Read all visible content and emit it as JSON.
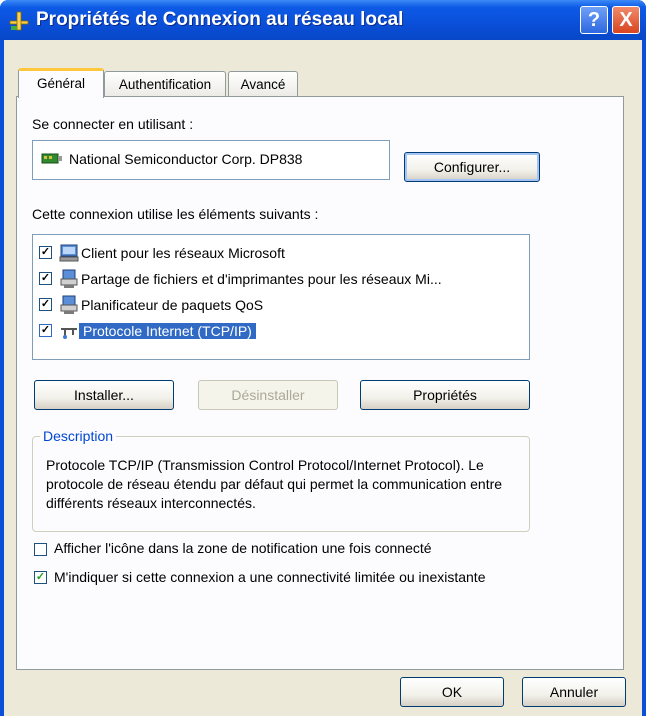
{
  "window": {
    "title": "Propriétés de Connexion au réseau local",
    "help_label": "?",
    "close_label": "X"
  },
  "tabs": [
    {
      "label": "Général",
      "active": true
    },
    {
      "label": "Authentification",
      "active": false
    },
    {
      "label": "Avancé",
      "active": false
    }
  ],
  "general": {
    "connect_using_label": "Se connecter en utilisant :",
    "adapter_name": "National Semiconductor Corp. DP838",
    "configure_label": "Configurer...",
    "items_label": "Cette connexion utilise les éléments suivants :",
    "items": [
      {
        "label": "Client pour les réseaux Microsoft",
        "checked": true,
        "icon": "network-client-icon"
      },
      {
        "label": "Partage de fichiers et d'imprimantes pour les réseaux Mi...",
        "checked": true,
        "icon": "file-sharing-icon"
      },
      {
        "label": "Planificateur de paquets QoS",
        "checked": true,
        "icon": "qos-icon"
      },
      {
        "label": "Protocole Internet (TCP/IP)",
        "checked": true,
        "selected": true,
        "icon": "protocol-icon"
      }
    ],
    "install_label": "Installer...",
    "uninstall_label": "Désinstaller",
    "properties_label": "Propriétés",
    "description_title": "Description",
    "description_text": "Protocole TCP/IP (Transmission Control Protocol/Internet Protocol). Le protocole de réseau étendu par défaut qui permet la communication entre différents réseaux interconnectés.",
    "show_icon_label": "Afficher l'icône dans la zone de notification une fois connecté",
    "show_icon_checked": false,
    "notify_limited_label": "M'indiquer si cette connexion a une connectivité limitée ou inexistante",
    "notify_limited_checked": true
  },
  "footer": {
    "ok_label": "OK",
    "cancel_label": "Annuler"
  },
  "colors": {
    "titlebar": "#0a4fd8",
    "dialog_bg": "#ece9d8",
    "selection": "#316ac5",
    "group_title": "#0046d5"
  }
}
